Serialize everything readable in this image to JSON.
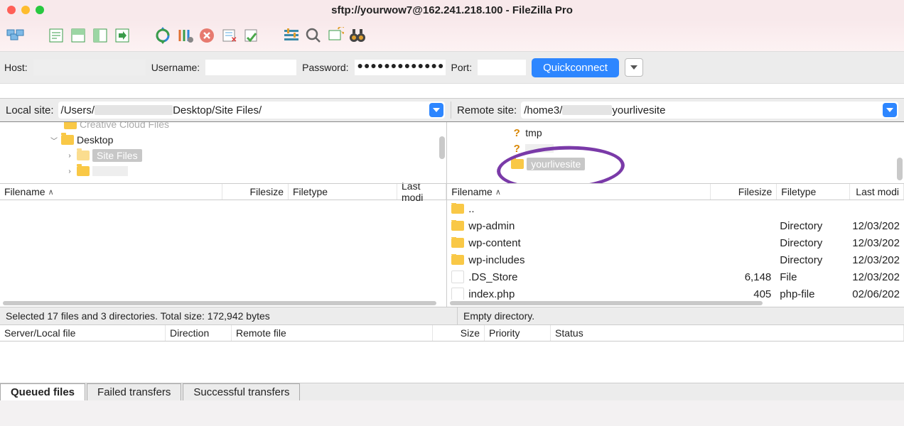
{
  "window": {
    "title": "sftp://yourwow7@162.241.218.100 - FileZilla Pro"
  },
  "quickbar": {
    "host_label": "Host:",
    "user_label": "Username:",
    "pass_label": "Password:",
    "port_label": "Port:",
    "password_value": "●●●●●●●●●●●●●",
    "connect_label": "Quickconnect"
  },
  "sites": {
    "local_label": "Local site:",
    "remote_label": "Remote site:",
    "local_path_prefix": "/Users/",
    "local_path_suffix": "Desktop/Site Files/",
    "remote_path_prefix": "/home3/",
    "remote_path_suffix": "yourlivesite"
  },
  "local_tree": {
    "item0": "Creative Cloud Files",
    "item1": "Desktop",
    "item1_child0": "Site Files"
  },
  "remote_tree": {
    "item0": "tmp",
    "item2": "yourlivesite"
  },
  "columns": {
    "filename": "Filename",
    "filesize": "Filesize",
    "filetype": "Filetype",
    "lastmod": "Last modi"
  },
  "remote_files": {
    "r0": {
      "name": "..",
      "size": "",
      "type": "",
      "date": ""
    },
    "r1": {
      "name": "wp-admin",
      "size": "",
      "type": "Directory",
      "date": "12/03/202"
    },
    "r2": {
      "name": "wp-content",
      "size": "",
      "type": "Directory",
      "date": "12/03/202"
    },
    "r3": {
      "name": "wp-includes",
      "size": "",
      "type": "Directory",
      "date": "12/03/202"
    },
    "r4": {
      "name": ".DS_Store",
      "size": "6,148",
      "type": "File",
      "date": "12/03/202"
    },
    "r5": {
      "name": "index.php",
      "size": "405",
      "type": "php-file",
      "date": "02/06/202"
    }
  },
  "status": {
    "local": "Selected 17 files and 3 directories. Total size: 172,942 bytes",
    "remote": "Empty directory."
  },
  "queue_cols": {
    "server": "Server/Local file",
    "direction": "Direction",
    "remote": "Remote file",
    "size": "Size",
    "priority": "Priority",
    "status": "Status"
  },
  "tabs": {
    "queued": "Queued files",
    "failed": "Failed transfers",
    "success": "Successful transfers"
  }
}
